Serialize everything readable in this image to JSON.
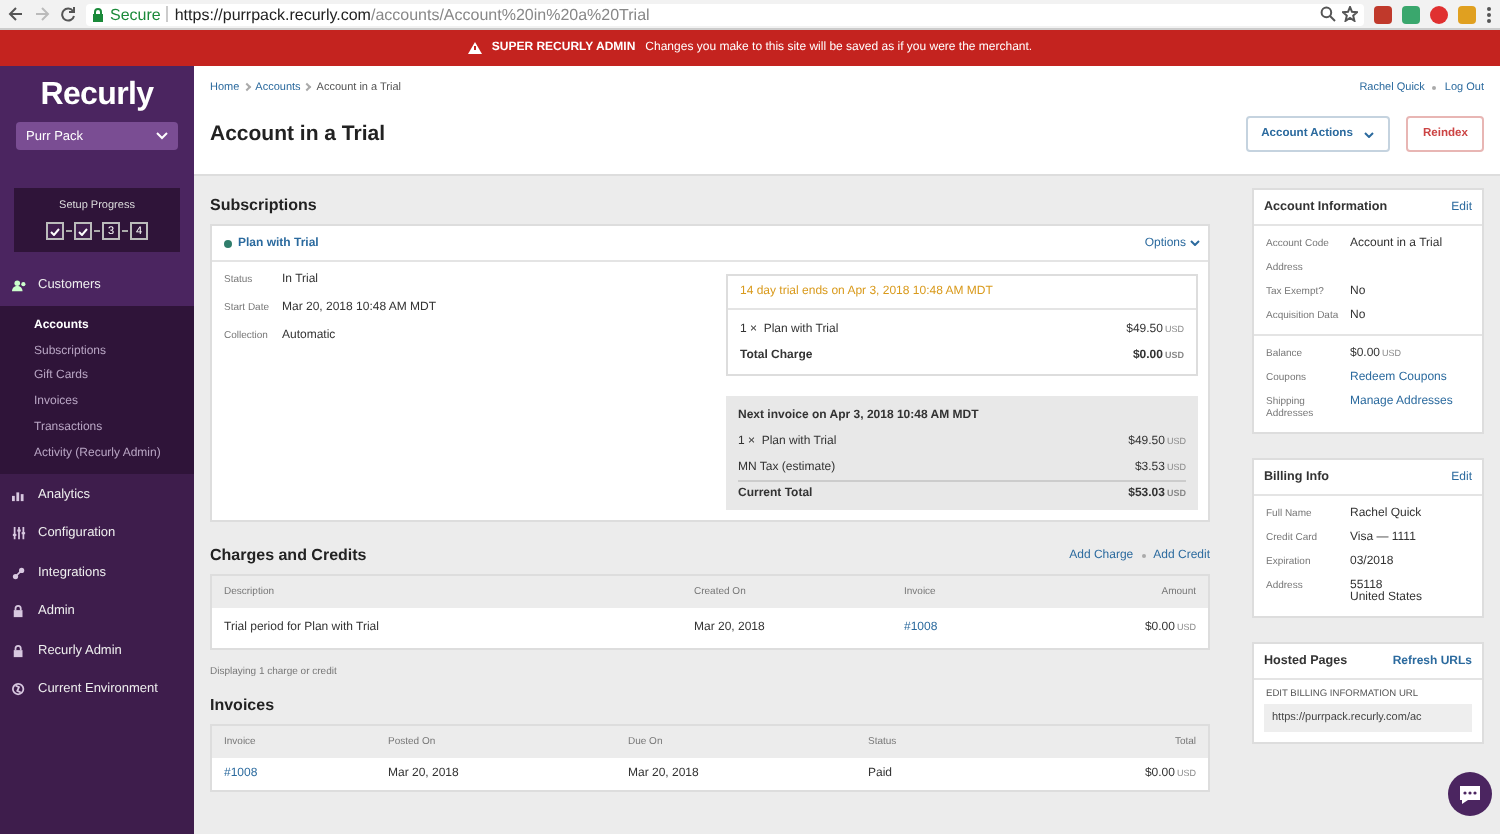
{
  "browser": {
    "secure": "Secure",
    "url_host": "https://purrpack.recurly.com",
    "url_path": "/accounts/Account%20in%20a%20Trial"
  },
  "banner": {
    "label": "SUPER RECURLY ADMIN",
    "message": "Changes you make to this site will be saved as if you were the merchant."
  },
  "sidebar": {
    "logo": "Recurly",
    "site": "Purr Pack",
    "setup": {
      "title": "Setup Progress",
      "steps": [
        {
          "done": true
        },
        {
          "done": true
        },
        {
          "label": "3",
          "done": false
        },
        {
          "label": "4",
          "done": false
        }
      ]
    },
    "nav": [
      {
        "label": "Customers",
        "kind": "people",
        "expanded": true,
        "children": [
          {
            "label": "Accounts",
            "selected": true
          },
          {
            "label": "Subscriptions",
            "selected": false
          },
          {
            "label": "Gift Cards",
            "selected": false
          },
          {
            "label": "Invoices",
            "selected": false
          },
          {
            "label": "Transactions",
            "selected": false
          },
          {
            "label": "Activity (Recurly Admin)",
            "selected": false
          }
        ]
      },
      {
        "label": "Analytics",
        "kind": "chart",
        "expanded": false
      },
      {
        "label": "Configuration",
        "kind": "sliders",
        "expanded": false
      },
      {
        "label": "Integrations",
        "kind": "plug",
        "expanded": false
      },
      {
        "label": "Admin",
        "kind": "lock",
        "expanded": false
      },
      {
        "label": "Recurly Admin",
        "kind": "lock",
        "expanded": false
      },
      {
        "label": "Current Environment",
        "kind": "globe",
        "expanded": false
      }
    ]
  },
  "header": {
    "breadcrumbs": [
      "Home",
      "Accounts",
      "Account in a Trial"
    ],
    "user": "Rachel Quick",
    "logout": "Log Out",
    "title": "Account in a Trial",
    "actions": [
      {
        "label": "Account Actions",
        "kind": "dropdown"
      },
      {
        "label": "Reindex",
        "kind": "danger"
      }
    ]
  },
  "subscriptions": {
    "title": "Subscriptions",
    "plan": {
      "name": "Plan with Trial",
      "color": "#2f7d6b"
    },
    "options": "Options",
    "details": [
      {
        "label": "Status",
        "value": "In Trial"
      },
      {
        "label": "Start Date",
        "value": "Mar 20, 2018 10:48 AM MDT"
      },
      {
        "label": "Collection",
        "value": "Automatic"
      }
    ],
    "trial": {
      "notice": "14 day trial ends on Apr 3, 2018 10:48 AM MDT",
      "lines": [
        {
          "qty": "1 ×",
          "name": "Plan with Trial",
          "amount": "$49.50",
          "currency": "USD"
        }
      ],
      "total": {
        "label": "Total Charge",
        "amount": "$0.00",
        "currency": "USD"
      }
    },
    "next_invoice": {
      "title": "Next invoice on Apr 3, 2018 10:48 AM MDT",
      "lines": [
        {
          "qty": "1 ×",
          "name": "Plan with Trial",
          "amount": "$49.50",
          "currency": "USD"
        },
        {
          "name": "MN Tax (estimate)",
          "amount": "$3.53",
          "currency": "USD"
        }
      ],
      "total": {
        "label": "Current Total",
        "amount": "$53.03",
        "currency": "USD"
      }
    }
  },
  "charges": {
    "title": "Charges and Credits",
    "actions": [
      "Add Charge",
      "Add Credit"
    ],
    "columns": [
      "Description",
      "Created On",
      "Invoice",
      "Amount"
    ],
    "rows": [
      {
        "description": "Trial period for Plan with Trial",
        "created_on": "Mar 20, 2018",
        "invoice": "#1008",
        "amount": "$0.00",
        "currency": "USD"
      }
    ],
    "footer": "Displaying 1 charge or credit"
  },
  "invoices": {
    "title": "Invoices",
    "columns": [
      "Invoice",
      "Posted On",
      "Due On",
      "Status",
      "Total"
    ],
    "rows": [
      {
        "invoice": "#1008",
        "posted_on": "Mar 20, 2018",
        "due_on": "Mar 20, 2018",
        "status": "Paid",
        "total": "$0.00",
        "currency": "USD"
      }
    ]
  },
  "account_info": {
    "title": "Account Information",
    "edit": "Edit",
    "fields": [
      {
        "label": "Account Code",
        "value": "Account in a Trial"
      },
      {
        "label": "Address"
      },
      {
        "label": "Tax Exempt?",
        "value": "No"
      },
      {
        "label": "Acquisition Data",
        "value": "No"
      }
    ],
    "fields_2": [
      {
        "label": "Balance",
        "value": "$0.00",
        "currency": "USD"
      },
      {
        "label": "Coupons",
        "link": "Redeem Coupons"
      },
      {
        "label": "Shipping Addresses",
        "link": "Manage Addresses"
      }
    ]
  },
  "billing_info": {
    "title": "Billing Info",
    "edit": "Edit",
    "fields": [
      {
        "label": "Full Name",
        "value": "Rachel Quick"
      },
      {
        "label": "Credit Card",
        "value": "Visa — 1111"
      },
      {
        "label": "Expiration",
        "value": "03/2018"
      },
      {
        "label": "Address",
        "value": "55118",
        "value_2": "United States"
      }
    ]
  },
  "hosted_pages": {
    "title": "Hosted Pages",
    "action": "Refresh URLs",
    "url_label": "EDIT BILLING INFORMATION URL",
    "url_value": "https://purrpack.recurly.com/ac"
  }
}
